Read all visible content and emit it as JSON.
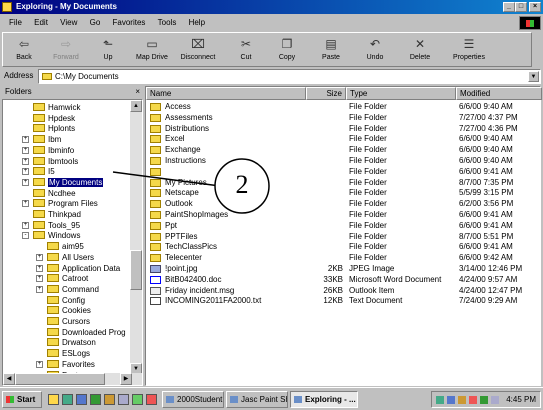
{
  "window": {
    "title": "Exploring - My Documents",
    "controls": [
      "_",
      "□",
      "×"
    ]
  },
  "menu": [
    "File",
    "Edit",
    "View",
    "Go",
    "Favorites",
    "Tools",
    "Help"
  ],
  "toolbar": [
    {
      "label": "Back",
      "icon": "back-arrow",
      "enabled": true
    },
    {
      "label": "Forward",
      "icon": "forward-arrow",
      "enabled": false
    },
    {
      "label": "Up",
      "icon": "up-folder",
      "enabled": true
    },
    {
      "label": "Map Drive",
      "icon": "map-drive",
      "enabled": true
    },
    {
      "label": "Disconnect",
      "icon": "disconnect",
      "enabled": true
    },
    {
      "label": "Cut",
      "icon": "scissors",
      "enabled": true
    },
    {
      "label": "Copy",
      "icon": "copy",
      "enabled": true
    },
    {
      "label": "Paste",
      "icon": "paste",
      "enabled": true
    },
    {
      "label": "Undo",
      "icon": "undo",
      "enabled": true
    },
    {
      "label": "Delete",
      "icon": "delete-x",
      "enabled": true
    },
    {
      "label": "Properties",
      "icon": "properties",
      "enabled": true
    }
  ],
  "address": {
    "label": "Address",
    "value": "C:\\My Documents"
  },
  "folders_pane": {
    "title": "Folders",
    "close": "×",
    "items": [
      {
        "label": "Hamwick",
        "expander": ""
      },
      {
        "label": "Hpdesk",
        "expander": ""
      },
      {
        "label": "Hplonts",
        "expander": ""
      },
      {
        "label": "Ibm",
        "expander": "+"
      },
      {
        "label": "Ibminfo",
        "expander": "+"
      },
      {
        "label": "Ibmtools",
        "expander": "+"
      },
      {
        "label": "I5",
        "expander": "+"
      },
      {
        "label": "My Documents",
        "expander": "+",
        "selected": true
      },
      {
        "label": "Ncdhee",
        "expander": ""
      },
      {
        "label": "Program Files",
        "expander": "+"
      },
      {
        "label": "Thinkpad",
        "expander": ""
      },
      {
        "label": "Tools_95",
        "expander": "+"
      },
      {
        "label": "Windows",
        "expander": "-"
      },
      {
        "label": "aim95",
        "expander": ""
      },
      {
        "label": "All Users",
        "expander": "+"
      },
      {
        "label": "Application Data",
        "expander": "+"
      },
      {
        "label": "Catroot",
        "expander": "+"
      },
      {
        "label": "Command",
        "expander": "+"
      },
      {
        "label": "Config",
        "expander": ""
      },
      {
        "label": "Cookies",
        "expander": ""
      },
      {
        "label": "Cursors",
        "expander": ""
      },
      {
        "label": "Downloaded Prog",
        "expander": ""
      },
      {
        "label": "Drwatson",
        "expander": ""
      },
      {
        "label": "ESLogs",
        "expander": ""
      },
      {
        "label": "Favorites",
        "expander": "+"
      },
      {
        "label": "Fonts",
        "expander": ""
      }
    ]
  },
  "file_list": {
    "columns": [
      "Name",
      "Size",
      "Type",
      "Modified"
    ],
    "rows": [
      {
        "name": "Access",
        "size": "",
        "type": "File Folder",
        "modified": "6/6/00 9:40 AM",
        "icon": "folder"
      },
      {
        "name": "Assessments",
        "size": "",
        "type": "File Folder",
        "modified": "7/27/00 4:37 PM",
        "icon": "folder"
      },
      {
        "name": "Distributions",
        "size": "",
        "type": "File Folder",
        "modified": "7/27/00 4:36 PM",
        "icon": "folder"
      },
      {
        "name": "Excel",
        "size": "",
        "type": "File Folder",
        "modified": "6/6/00 9:40 AM",
        "icon": "folder"
      },
      {
        "name": "Exchange",
        "size": "",
        "type": "File Folder",
        "modified": "6/6/00 9:40 AM",
        "icon": "folder"
      },
      {
        "name": "Instructions",
        "size": "",
        "type": "File Folder",
        "modified": "6/6/00 9:40 AM",
        "icon": "folder"
      },
      {
        "name": "",
        "size": "",
        "type": "File Folder",
        "modified": "6/6/00 9:41 AM",
        "icon": "folder"
      },
      {
        "name": "My Pictures",
        "size": "",
        "type": "File Folder",
        "modified": "8/7/00 7:35 PM",
        "icon": "folder"
      },
      {
        "name": "Netscape",
        "size": "",
        "type": "File Folder",
        "modified": "5/5/99 3:15 PM",
        "icon": "folder"
      },
      {
        "name": "Outlook",
        "size": "",
        "type": "File Folder",
        "modified": "6/2/00 3:56 PM",
        "icon": "folder"
      },
      {
        "name": "PaintShopImages",
        "size": "",
        "type": "File Folder",
        "modified": "6/6/00 9:41 AM",
        "icon": "folder"
      },
      {
        "name": "Ppt",
        "size": "",
        "type": "File Folder",
        "modified": "6/6/00 9:41 AM",
        "icon": "folder"
      },
      {
        "name": "PPTFiles",
        "size": "",
        "type": "File Folder",
        "modified": "8/7/00 5:51 PM",
        "icon": "folder"
      },
      {
        "name": "TechClassPics",
        "size": "",
        "type": "File Folder",
        "modified": "6/6/00 9:41 AM",
        "icon": "folder"
      },
      {
        "name": "Telecenter",
        "size": "",
        "type": "File Folder",
        "modified": "6/6/00 9:42 AM",
        "icon": "folder"
      },
      {
        "name": "!point.jpg",
        "size": "2KB",
        "type": "JPEG Image",
        "modified": "3/14/00 12:46 PM",
        "icon": "jpg"
      },
      {
        "name": "BitB042400.doc",
        "size": "33KB",
        "type": "Microsoft Word Document",
        "modified": "4/24/00 9:57 AM",
        "icon": "doc"
      },
      {
        "name": "Friday incident.msg",
        "size": "26KB",
        "type": "Outlook Item",
        "modified": "4/24/00 12:47 PM",
        "icon": "msg"
      },
      {
        "name": "INCOMING2011FA2000.txt",
        "size": "12KB",
        "type": "Text Document",
        "modified": "7/24/00 9:29 AM",
        "icon": "txt"
      }
    ]
  },
  "annotation": {
    "number": "2"
  },
  "taskbar": {
    "start_label": "Start",
    "tasks": [
      {
        "label": "2000Student ...",
        "active": false
      },
      {
        "label": "Jasc Paint Sh...",
        "active": false
      },
      {
        "label": "Exploring - ...",
        "active": true
      }
    ],
    "clock": "4:45 PM"
  },
  "colors": {
    "titlebar": "#000080",
    "selection": "#000080",
    "chrome": "#c0c0c0",
    "folder": "#f5d94a"
  }
}
